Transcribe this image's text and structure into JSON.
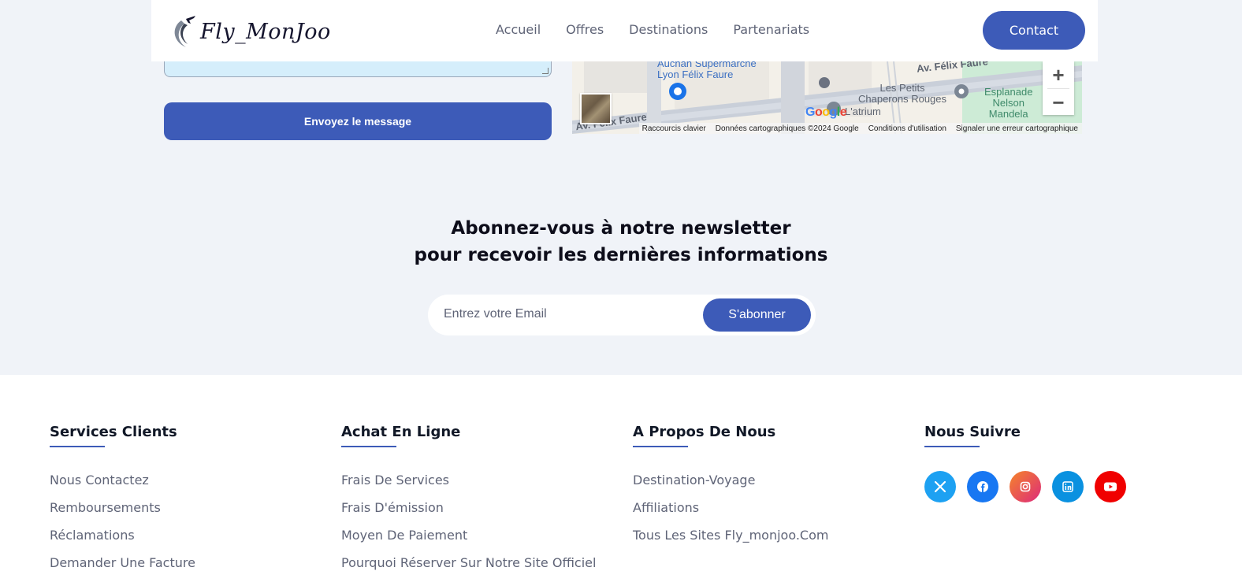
{
  "header": {
    "logo_text": "Fly_MonJoo",
    "nav": [
      "Accueil",
      "Offres",
      "Destinations",
      "Partenariats"
    ],
    "contact_label": "Contact"
  },
  "form": {
    "send_label": "Envoyez le message"
  },
  "map": {
    "labels": {
      "auchan": "Auchan Supermarché\nLyon Félix Faure",
      "avenue_top": "Av. Félix Faure",
      "avenue_bottom": "Av. Félix Faure",
      "chaperons": "Les Petits\nChaperons Rouges",
      "esplanade": "Esplanade\nNelson\nMandela",
      "atrium": "L'atrium"
    },
    "google": "Google",
    "attribution": [
      "Raccourcis clavier",
      "Données cartographiques ©2024 Google",
      "Conditions d'utilisation",
      "Signaler une erreur cartographique"
    ],
    "zoom_in": "+",
    "zoom_out": "−"
  },
  "newsletter": {
    "title_line1": "Abonnez-vous à notre newsletter",
    "title_line2": "pour recevoir les dernières informations",
    "email_placeholder": "Entrez votre Email",
    "subscribe_label": "S'abonner"
  },
  "footer": {
    "columns": [
      {
        "heading": "Services Clients",
        "links": [
          "Nous Contactez",
          "Remboursements",
          "Réclamations",
          "Demander Une Facture"
        ]
      },
      {
        "heading": "Achat En Ligne",
        "links": [
          "Frais De Services",
          "Frais D'émission",
          "Moyen De Paiement",
          "Pourquoi Réserver Sur Notre Site Officiel"
        ]
      },
      {
        "heading": "A Propos De Nous",
        "links": [
          "Destination-Voyage",
          "Affiliations",
          "Tous Les Sites Fly_monjoo.Com"
        ]
      },
      {
        "heading": "Nous Suivre",
        "social": [
          {
            "icon": "x-twitter-icon",
            "color": "#1da1f2"
          },
          {
            "icon": "facebook-icon",
            "color": "#1877f2"
          },
          {
            "icon": "instagram-icon",
            "color": "#f56040"
          },
          {
            "icon": "linkedin-icon",
            "color": "#0a91e0"
          },
          {
            "icon": "youtube-icon",
            "color": "#f00000"
          }
        ]
      }
    ]
  },
  "colors": {
    "accent": "#3d5bb8",
    "section_bg": "#f0f3f8",
    "muted_text": "#5f6477"
  }
}
